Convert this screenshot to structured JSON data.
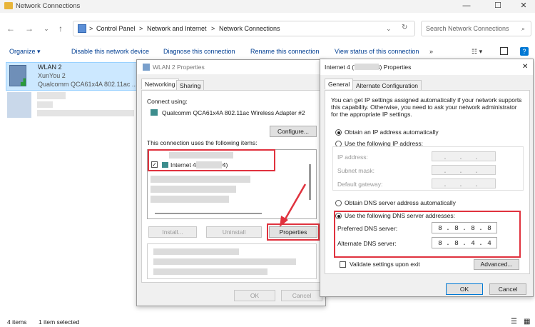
{
  "window": {
    "title": "Network Connections",
    "controls": {
      "minimize": "—",
      "maximize": "☐",
      "close": "✕"
    }
  },
  "address": {
    "breadcrumbs": [
      "Control Panel",
      "Network and Internet",
      "Network Connections"
    ],
    "separator": ">",
    "search_placeholder": "Search Network Connections"
  },
  "commandbar": {
    "organize": "Organize ▾",
    "items": [
      "Disable this network device",
      "Diagnose this connection",
      "Rename this connection",
      "View status of this connection"
    ],
    "more": "»"
  },
  "adapter": {
    "name": "WLAN 2",
    "network": "XunYou 2",
    "device": "Qualcomm QCA61x4A 802.11ac ..."
  },
  "status": {
    "items_count": "4 items",
    "selected": "1 item selected"
  },
  "wlan_dialog": {
    "title": "WLAN 2 Properties",
    "tabs": [
      "Networking",
      "Sharing"
    ],
    "connect_using_label": "Connect using:",
    "adapter_name": "Qualcomm QCA61x4A 802.11ac Wireless Adapter #2",
    "configure": "Configure...",
    "items_label": "This connection uses the following items:",
    "tcp_item": "Internet            4 (TCP/IPv4)",
    "install": "Install...",
    "uninstall": "Uninstall",
    "properties": "Properties",
    "ok": "OK",
    "cancel": "Cancel"
  },
  "ipv4_dialog": {
    "title": "Internet            4 (TCP/IPv4) Properties",
    "tabs": [
      "General",
      "Alternate Configuration"
    ],
    "description": "You can get IP settings assigned automatically if your network supports this capability. Otherwise, you need to ask your network administrator for the appropriate IP settings.",
    "obtain_ip_auto": "Obtain an IP address automatically",
    "use_following_ip": "Use the following IP address:",
    "ip_address_label": "IP address:",
    "subnet_mask_label": "Subnet mask:",
    "default_gateway_label": "Default gateway:",
    "obtain_dns_auto": "Obtain DNS server address automatically",
    "use_following_dns": "Use the following DNS server addresses:",
    "preferred_dns_label": "Preferred DNS server:",
    "alternate_dns_label": "Alternate DNS server:",
    "preferred_dns": [
      "8",
      "8",
      "8",
      "8"
    ],
    "alternate_dns": [
      "8",
      "8",
      "4",
      "4"
    ],
    "validate_label": "Validate settings upon exit",
    "advanced": "Advanced...",
    "ok": "OK",
    "cancel": "Cancel"
  },
  "colors": {
    "highlight": "#e0323e",
    "selection": "#cce8ff",
    "link": "#003e92"
  }
}
